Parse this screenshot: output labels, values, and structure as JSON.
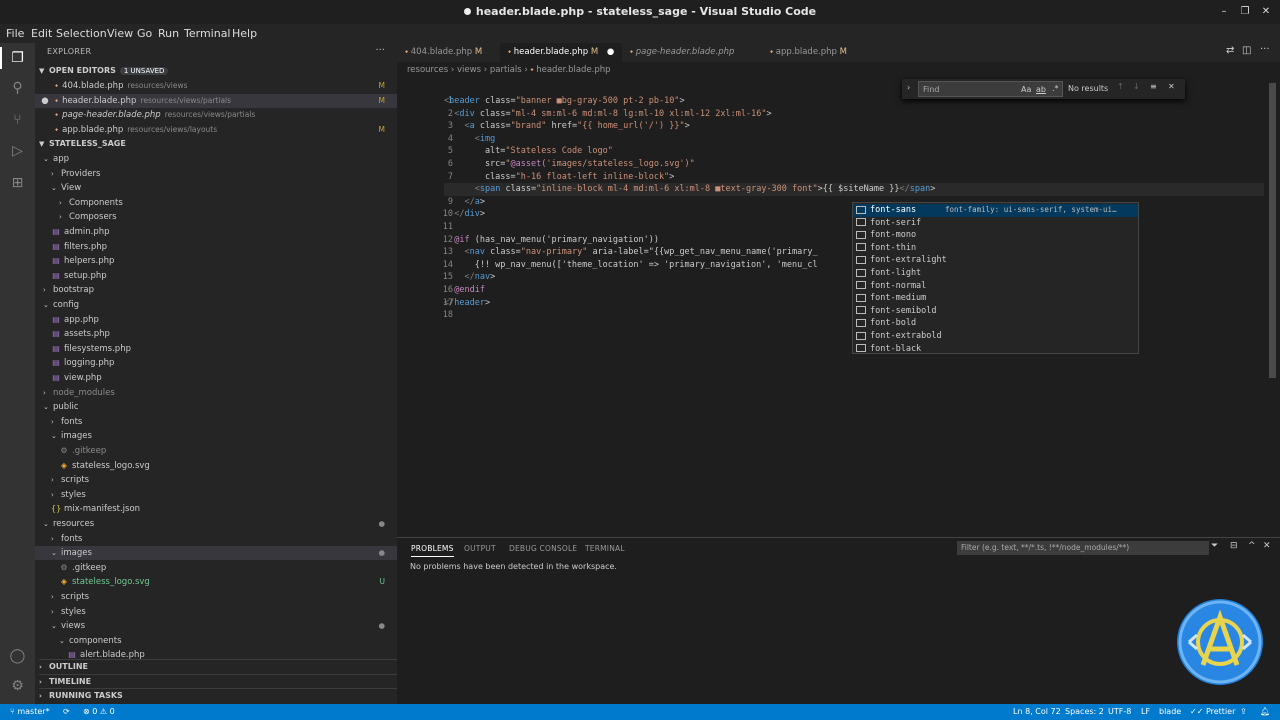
{
  "window": {
    "title": "header.blade.php - stateless_sage - Visual Studio Code"
  },
  "menu": [
    "File",
    "Edit",
    "Selection",
    "View",
    "Go",
    "Run",
    "Terminal",
    "Help"
  ],
  "explorer": {
    "title": "EXPLORER",
    "open_editors_label": "OPEN EDITORS",
    "unsaved_badge": "1 UNSAVED",
    "open_editors": [
      {
        "name": "404.blade.php",
        "path": "resources/views",
        "status": "M"
      },
      {
        "name": "header.blade.php",
        "path": "resources/views/partials",
        "status": "M"
      },
      {
        "name": "page-header.blade.php",
        "path": "resources/views/partials",
        "status": ""
      },
      {
        "name": "app.blade.php",
        "path": "resources/views/layouts",
        "status": "M"
      }
    ],
    "project_label": "STATELESS_SAGE",
    "tree": [
      {
        "name": "app",
        "kind": "folder-open",
        "depth": 0,
        "status": ""
      },
      {
        "name": "Providers",
        "kind": "folder",
        "depth": 1,
        "status": ""
      },
      {
        "name": "View",
        "kind": "folder-open",
        "depth": 1,
        "status": ""
      },
      {
        "name": "Components",
        "kind": "folder",
        "depth": 2,
        "status": ""
      },
      {
        "name": "Composers",
        "kind": "folder",
        "depth": 2,
        "status": ""
      },
      {
        "name": "admin.php",
        "kind": "php",
        "depth": 1,
        "status": ""
      },
      {
        "name": "filters.php",
        "kind": "php",
        "depth": 1,
        "status": ""
      },
      {
        "name": "helpers.php",
        "kind": "php",
        "depth": 1,
        "status": ""
      },
      {
        "name": "setup.php",
        "kind": "php",
        "depth": 1,
        "status": ""
      },
      {
        "name": "bootstrap",
        "kind": "folder",
        "depth": 0,
        "status": ""
      },
      {
        "name": "config",
        "kind": "folder-open",
        "depth": 0,
        "status": ""
      },
      {
        "name": "app.php",
        "kind": "php",
        "depth": 1,
        "status": ""
      },
      {
        "name": "assets.php",
        "kind": "php",
        "depth": 1,
        "status": ""
      },
      {
        "name": "filesystems.php",
        "kind": "php",
        "depth": 1,
        "status": ""
      },
      {
        "name": "logging.php",
        "kind": "php",
        "depth": 1,
        "status": ""
      },
      {
        "name": "view.php",
        "kind": "php",
        "depth": 1,
        "status": ""
      },
      {
        "name": "node_modules",
        "kind": "folder-dim",
        "depth": 0,
        "status": ""
      },
      {
        "name": "public",
        "kind": "folder-open",
        "depth": 0,
        "status": ""
      },
      {
        "name": "fonts",
        "kind": "folder",
        "depth": 1,
        "status": ""
      },
      {
        "name": "images",
        "kind": "folder-open",
        "depth": 1,
        "status": ""
      },
      {
        "name": ".gitkeep",
        "kind": "file-dim",
        "depth": 2,
        "status": ""
      },
      {
        "name": "stateless_logo.svg",
        "kind": "svg",
        "depth": 2,
        "status": ""
      },
      {
        "name": "scripts",
        "kind": "folder",
        "depth": 1,
        "status": ""
      },
      {
        "name": "styles",
        "kind": "folder",
        "depth": 1,
        "status": ""
      },
      {
        "name": "mix-manifest.json",
        "kind": "json",
        "depth": 1,
        "status": ""
      },
      {
        "name": "resources",
        "kind": "folder-open-mod",
        "depth": 0,
        "status": "●"
      },
      {
        "name": "fonts",
        "kind": "folder",
        "depth": 1,
        "status": ""
      },
      {
        "name": "images",
        "kind": "folder-open-mod",
        "depth": 1,
        "status": "●"
      },
      {
        "name": ".gitkeep",
        "kind": "file",
        "depth": 2,
        "status": ""
      },
      {
        "name": "stateless_logo.svg",
        "kind": "svg-new",
        "depth": 2,
        "status": "U"
      },
      {
        "name": "scripts",
        "kind": "folder",
        "depth": 1,
        "status": ""
      },
      {
        "name": "styles",
        "kind": "folder",
        "depth": 1,
        "status": ""
      },
      {
        "name": "views",
        "kind": "folder-open-mod",
        "depth": 1,
        "status": "●"
      },
      {
        "name": "components",
        "kind": "folder-open",
        "depth": 2,
        "status": ""
      },
      {
        "name": "alert.blade.php",
        "kind": "php",
        "depth": 3,
        "status": ""
      }
    ],
    "outline_label": "OUTLINE",
    "timeline_label": "TIMELINE",
    "running_tasks_label": "RUNNING TASKS"
  },
  "tabs": [
    {
      "name": "404.blade.php",
      "status": "M",
      "active": false,
      "italic": false
    },
    {
      "name": "header.blade.php",
      "status": "M",
      "active": true,
      "italic": false
    },
    {
      "name": "page-header.blade.php",
      "status": "",
      "active": false,
      "italic": true
    },
    {
      "name": "app.blade.php",
      "status": "M",
      "active": false,
      "italic": false
    }
  ],
  "breadcrumbs": [
    "resources",
    "views",
    "partials",
    "header.blade.php"
  ],
  "find": {
    "placeholder": "Find",
    "aa": "Aa",
    "ab": "ab",
    "regex": ".*",
    "result": "No results"
  },
  "code_lines": [
    "<header class=\"banner ■bg-gray-500 pt-2 pb-10\">",
    "  <div class=\"ml-4 sm:ml-6 md:ml-8 lg:ml-10 xl:ml-12 2xl:ml-16\">",
    "    <a class=\"brand\" href=\"{{ home_url('/') }}\">",
    "      <img",
    "        alt=\"Stateless Code logo\"",
    "        src=\"@asset('images/stateless_logo.svg')\"",
    "        class=\"h-16 float-left inline-block\">",
    "      <span class=\"inline-block ml-4 md:ml-6 xl:ml-8 ■text-gray-300 font\">{{ $siteName }}</span>",
    "    </a>",
    "  </div>",
    "",
    "  @if (has_nav_menu('primary_navigation'))",
    "    <nav class=\"nav-primary\" aria-label=\"{{wp_get_nav_menu_name('primary_",
    "      {!! wp_nav_menu(['theme_location' => 'primary_navigation', 'menu_cl",
    "    </nav>",
    "  @endif",
    "</header>",
    ""
  ],
  "suggestions": {
    "detail": "font-family: ui-sans-serif, system-ui…",
    "items": [
      "font-sans",
      "font-serif",
      "font-mono",
      "font-thin",
      "font-extralight",
      "font-light",
      "font-normal",
      "font-medium",
      "font-semibold",
      "font-bold",
      "font-extrabold",
      "font-black"
    ]
  },
  "panel": {
    "tabs": [
      "PROBLEMS",
      "OUTPUT",
      "DEBUG CONSOLE",
      "TERMINAL"
    ],
    "filter_placeholder": "Filter (e.g. text, **/*.ts, !**/node_modules/**)",
    "message": "No problems have been detected in the workspace."
  },
  "status": {
    "branch": "master*",
    "problems": "0",
    "warnings": "0",
    "position": "Ln 8, Col 72",
    "spaces": "Spaces: 2",
    "encoding": "UTF-8",
    "eol": "LF",
    "language": "blade",
    "prettier": "Prettier"
  },
  "colors": {
    "accent": "#007acc",
    "modified": "#e2c08d",
    "untracked": "#73c991",
    "suggest_highlight": "#18a3ff"
  }
}
